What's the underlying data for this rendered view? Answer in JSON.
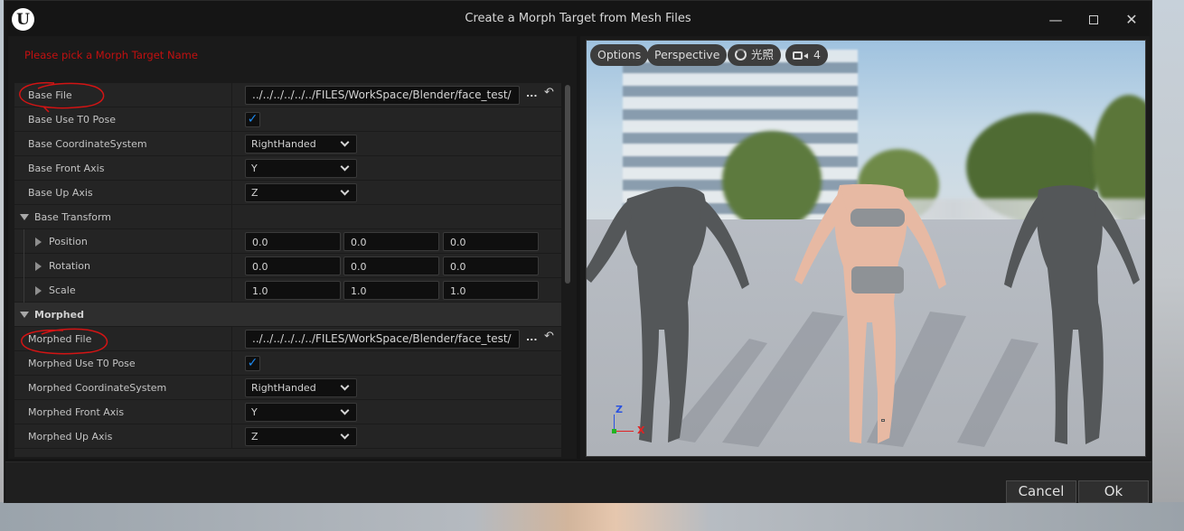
{
  "window": {
    "logo": "U",
    "title": "Create a Morph Target from Mesh Files",
    "minimize": "—",
    "close": "✕"
  },
  "message": "Please pick a Morph Target Name",
  "rows": {
    "base_file": {
      "label": "Base File",
      "value": "../../../../../../FILES/WorkSpace/Blender/face_test/"
    },
    "base_use_t0": {
      "label": "Base Use T0 Pose",
      "checked": "✓"
    },
    "base_coord": {
      "label": "Base CoordinateSystem",
      "value": "RightHanded"
    },
    "base_front": {
      "label": "Base Front Axis",
      "value": "Y"
    },
    "base_up": {
      "label": "Base Up Axis",
      "value": "Z"
    },
    "base_transform": {
      "label": "Base Transform"
    },
    "position": {
      "label": "Position",
      "x": "0.0",
      "y": "0.0",
      "z": "0.0"
    },
    "rotation": {
      "label": "Rotation",
      "x": "0.0",
      "y": "0.0",
      "z": "0.0"
    },
    "scale": {
      "label": "Scale",
      "x": "1.0",
      "y": "1.0",
      "z": "1.0"
    },
    "morphed_category": {
      "label": "Morphed"
    },
    "morphed_file": {
      "label": "Morphed File",
      "value": "../../../../../../FILES/WorkSpace/Blender/face_test/"
    },
    "morphed_use_t0": {
      "label": "Morphed Use T0 Pose",
      "checked": "✓"
    },
    "morphed_coord": {
      "label": "Morphed CoordinateSystem",
      "value": "RightHanded"
    },
    "morphed_front": {
      "label": "Morphed Front Axis",
      "value": "Y"
    },
    "morphed_up": {
      "label": "Morphed Up Axis",
      "value": "Z"
    }
  },
  "browse_label": "...",
  "reset_icon": "↶",
  "viewport": {
    "options": "Options",
    "perspective": "Perspective",
    "lit": "光照",
    "camera_speed": "4",
    "axis_z": "Z",
    "axis_x": "X"
  },
  "footer": {
    "cancel": "Cancel",
    "ok": "Ok"
  },
  "colors": {
    "message_red": "#c21010",
    "checkbox_blue": "#1e8af0",
    "annotation_red": "#d31414"
  }
}
